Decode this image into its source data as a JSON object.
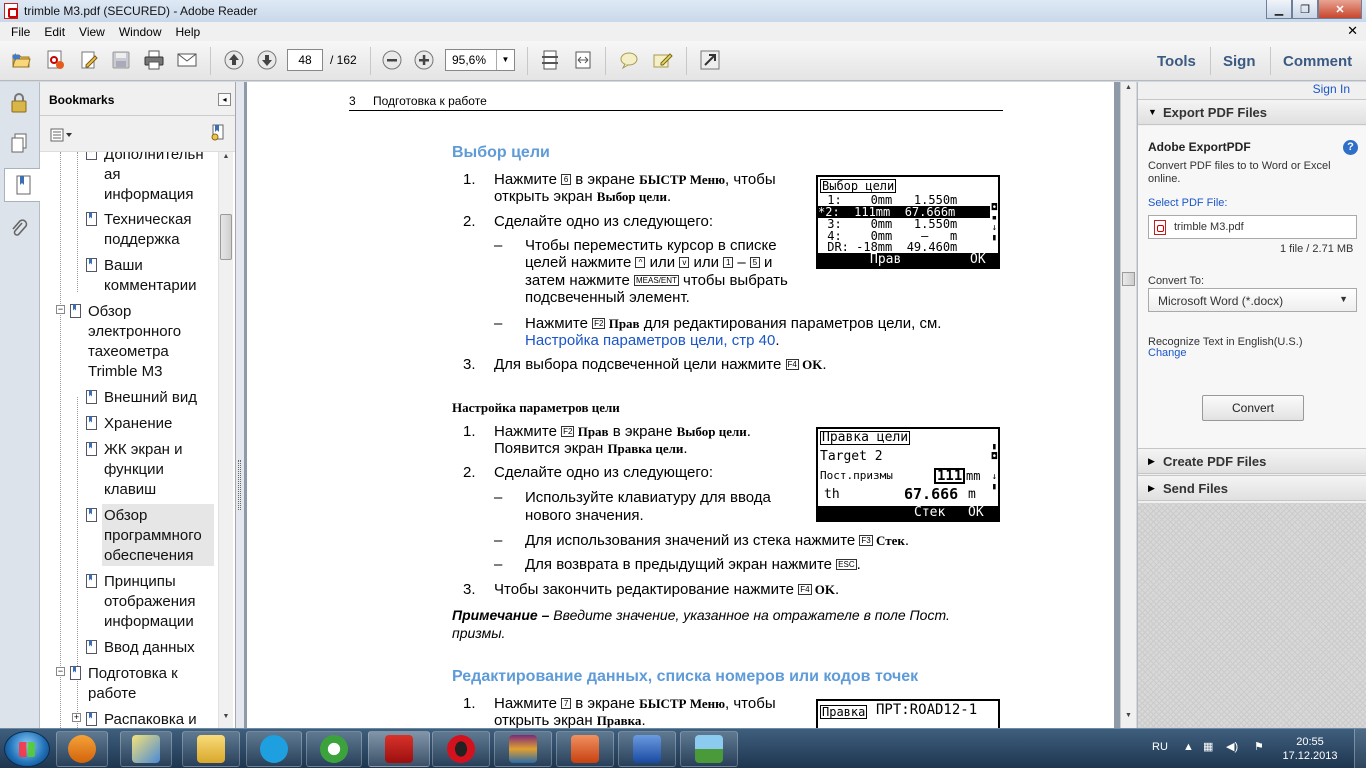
{
  "window": {
    "title": "trimble M3.pdf (SECURED) - Adobe Reader",
    "buttons": {
      "minimize": "▁",
      "maximize": "❐",
      "close": "✕"
    }
  },
  "menu": {
    "items": [
      "File",
      "Edit",
      "View",
      "Window",
      "Help"
    ],
    "close_doc": "✕"
  },
  "toolbar": {
    "page_current": "48",
    "page_total": "/ 162",
    "zoom": "95,6%",
    "tools_label": "Tools",
    "sign_label": "Sign",
    "comment_label": "Comment"
  },
  "bookmarks": {
    "title": "Bookmarks",
    "items": [
      {
        "label": "Дополнительн\nая\nинформация",
        "level": 2
      },
      {
        "label": "Техническая\nподдержка",
        "level": 2
      },
      {
        "label": "Ваши\nкомментарии",
        "level": 2
      },
      {
        "label": "Обзор\nэлектронного\nтахеометра\nTrimble M3",
        "level": 1,
        "toggle": "−"
      },
      {
        "label": "Внешний вид",
        "level": 2
      },
      {
        "label": "Хранение",
        "level": 2
      },
      {
        "label": "ЖК экран и\nфункции\nклавиш",
        "level": 2
      },
      {
        "label": "Обзор\nпрограммного\nобеспечения",
        "level": 2,
        "selected": true
      },
      {
        "label": "Принципы\nотображения\nинформации",
        "level": 2
      },
      {
        "label": "Ввод данных",
        "level": 2
      },
      {
        "label": "Подготовка к\nработе",
        "level": 1,
        "toggle": "−"
      },
      {
        "label": "Распаковка и",
        "level": 2,
        "toggle": "+"
      }
    ]
  },
  "document": {
    "header_num": "3",
    "header_title": "Подготовка к работе",
    "s1_title": "Выбор цели",
    "s1_step1_num": "1.",
    "s1_step1_a": "Нажмите ",
    "s1_step1_key": "6",
    "s1_step1_b": " в экране ",
    "s1_step1_bold": "БЫСТР Меню",
    "s1_step1_c": ", чтобы",
    "s1_step1_line2_a": "открыть экран ",
    "s1_step1_line2_bold": "Выбор цели",
    "s1_step1_line2_c": ".",
    "s1_step2_num": "2.",
    "s1_step2": "Сделайте одно из следующего:",
    "s1_d1_line1": "Чтобы переместить курсор в списке",
    "s1_d1_line2_a": "целей нажмите ",
    "s1_d1_k1": "^",
    "s1_d1_or1": " или ",
    "s1_d1_k2": "v",
    "s1_d1_or2": " или ",
    "s1_d1_k3": "1",
    "s1_d1_dash": " – ",
    "s1_d1_k4": "5",
    "s1_d1_and": " и",
    "s1_d1_line3_a": "затем нажмите ",
    "s1_d1_k5": "MEAS/ENT",
    "s1_d1_line3_b": " чтобы выбрать",
    "s1_d1_line4": "подсвеченный элемент.",
    "s1_d2_a": "Нажмите ",
    "s1_d2_key": "F2",
    "s1_d2_bold": " Прав",
    "s1_d2_b": " для редактирования параметров цели, см.",
    "s1_d2_link": "Настройка параметров цели, стр 40",
    "s1_d2_c": ".",
    "s1_step3_num": "3.",
    "s1_step3_a": "Для выбора подсвеченной цели нажмите ",
    "s1_step3_key": "F4",
    "s1_step3_bold": " OK",
    "s1_step3_c": ".",
    "s2_title": "Настройка параметров цели",
    "s2_step1_num": "1.",
    "s2_step1_a": "Нажмите ",
    "s2_step1_key": "F2",
    "s2_step1_bold": " Прав",
    "s2_step1_b": " в экране ",
    "s2_step1_bold2": "Выбор цели",
    "s2_step1_c": ".",
    "s2_step1_line2_a": "Появится экран ",
    "s2_step1_line2_bold": "Правка цели",
    "s2_step1_line2_c": ".",
    "s2_step2_num": "2.",
    "s2_step2": "Сделайте одно из следующего:",
    "s2_d1_line1": "Используйте клавиатуру для ввода",
    "s2_d1_line2": "нового значения.",
    "s2_d2_a": "Для использования значений из стека нажмите ",
    "s2_d2_key": "F3",
    "s2_d2_bold": " Стек",
    "s2_d2_c": ".",
    "s2_d3_a": "Для возврата в предыдущий экран нажмите ",
    "s2_d3_key": "ESC",
    "s2_d3_c": ".",
    "s2_step3_num": "3.",
    "s2_step3_a": "Чтобы закончить редактирование нажмите ",
    "s2_step3_key": "F4",
    "s2_step3_bold": " OK",
    "s2_step3_c": ".",
    "note_label": "Примечание –",
    "note_text": " Введите значение, указанное на отражателе в поле Пост.",
    "note_line2": "призмы.",
    "s3_title": "Редактирование данных, списка номеров или кодов точек",
    "s3_step1_num": "1.",
    "s3_step1_a": "Нажмите ",
    "s3_step1_key": "7",
    "s3_step1_b": " в экране ",
    "s3_step1_bold": "БЫСТР Меню",
    "s3_step1_c": ", чтобы",
    "s3_step1_line2_a": "открыть экран ",
    "s3_step1_line2_bold": "Правка",
    "s3_step1_line2_c": ".",
    "dash": "–"
  },
  "lcd1": {
    "title": "Выбор цели",
    "rows": [
      " 1:    0mm   1.550m",
      "*2:  111mm  67.666m",
      " 3:    0mm   1.550m",
      " 4:    0mm    –   m",
      " DR: -18mm  49.460m"
    ],
    "f2": "Прав",
    "f4": "ОК"
  },
  "lcd2": {
    "title": "Правка цели",
    "row1": "Target 2",
    "row2_label": "Пост.призмы",
    "row2_value": "111",
    "row2_unit": "mm",
    "row3_label": "th",
    "row3_value": "67.666",
    "row3_unit": "m",
    "f3": "Стек",
    "f4": "ОК"
  },
  "lcd3": {
    "title": "Правка",
    "row1": "ПРТ:ROAD12-1"
  },
  "right_pane": {
    "sign_in": "Sign In",
    "export_title": "Export PDF Files",
    "adobe_export": "Adobe ExportPDF",
    "help": "?",
    "description": "Convert PDF files to to Word or Excel online.",
    "select_label": "Select PDF File:",
    "file_name": "trimble M3.pdf",
    "file_info": "1 file / 2.71 MB",
    "convert_to": "Convert To:",
    "format": "Microsoft Word (*.docx)",
    "recognize": "Recognize Text in English(U.S.)",
    "change": "Change",
    "convert_button": "Convert",
    "create_title": "Create PDF Files",
    "send_title": "Send Files"
  },
  "taskbar": {
    "lang": "RU",
    "time": "20:55",
    "date": "17.12.2013"
  }
}
